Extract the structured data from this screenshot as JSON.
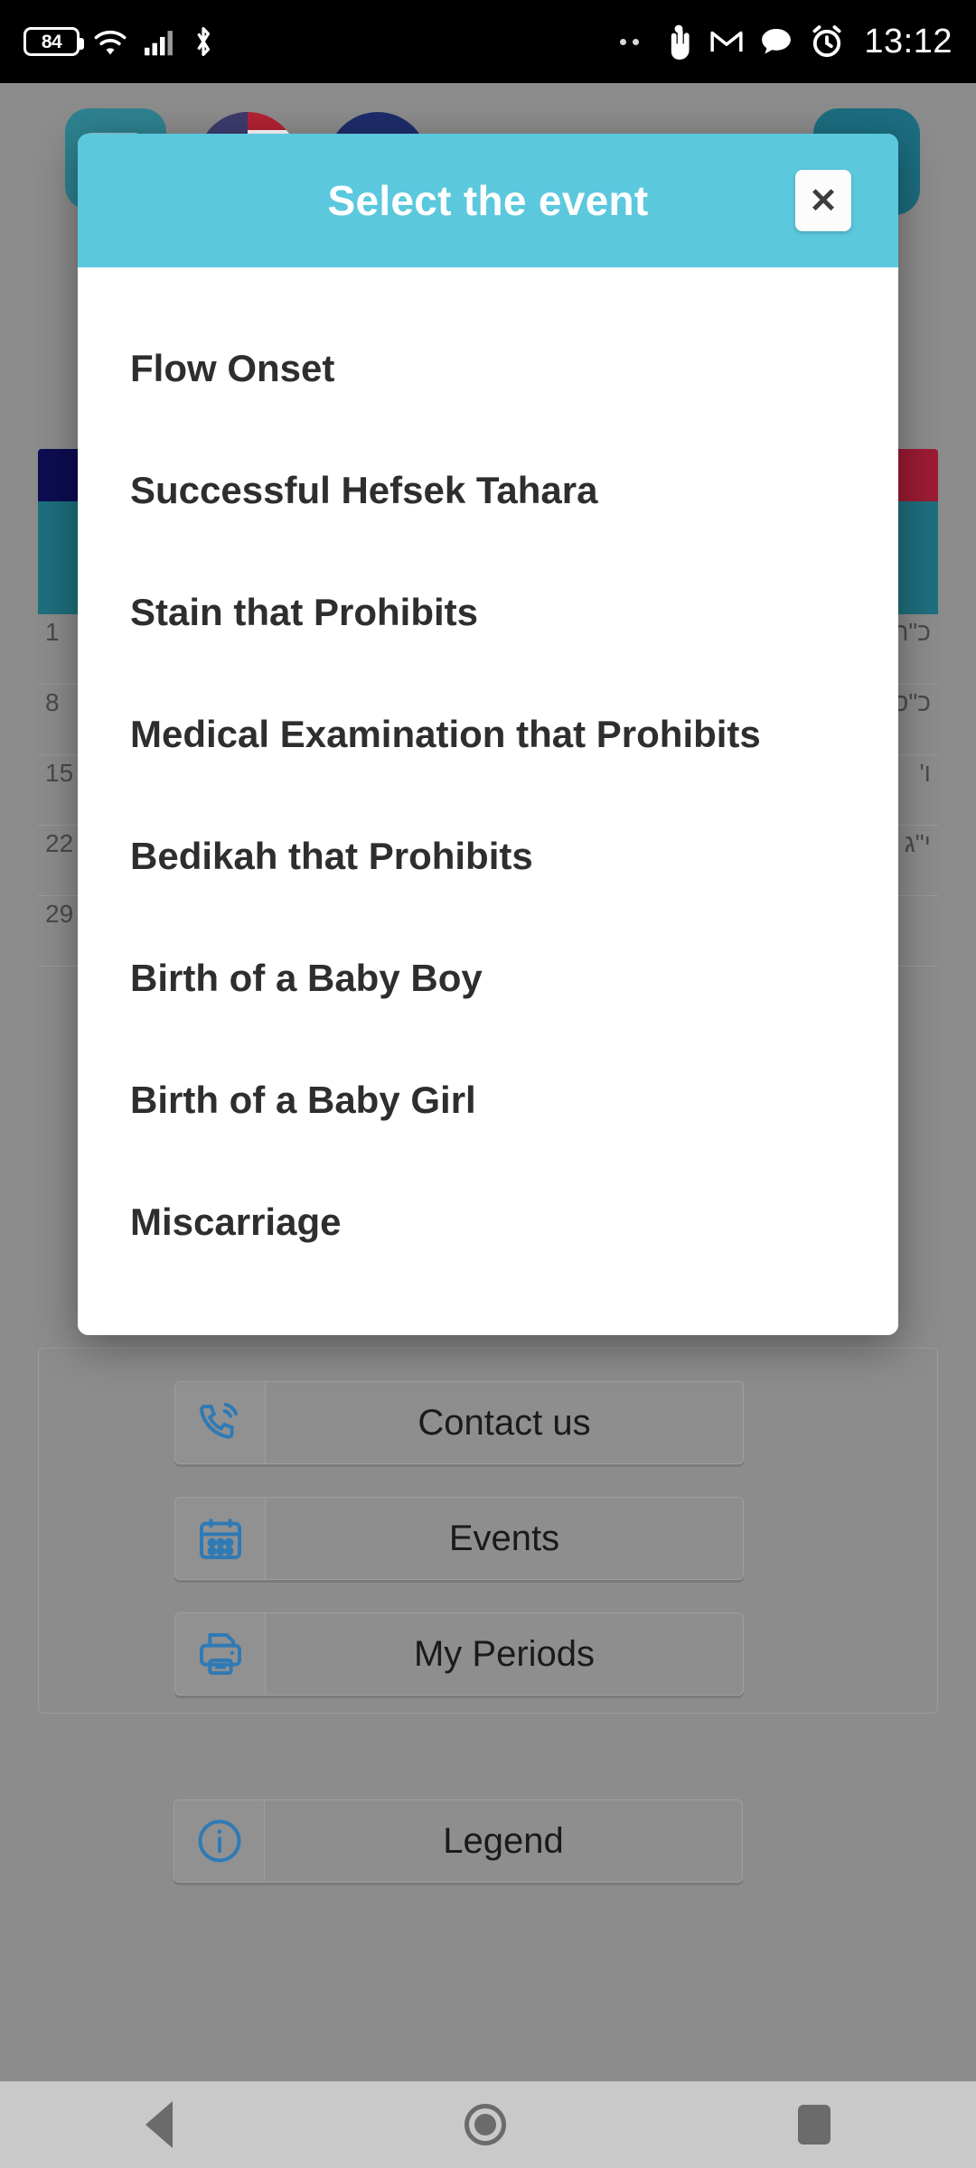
{
  "status_bar": {
    "battery_percent": "84",
    "icons_left": [
      "battery-icon",
      "wifi-icon",
      "signal-icon",
      "bluetooth-icon"
    ],
    "icons_right": [
      "two-dots-icon",
      "touch-hand-icon",
      "gmail-icon",
      "chat-bubble-icon",
      "alarm-clock-icon"
    ],
    "time": "13:12"
  },
  "dialog": {
    "title": "Select the event",
    "close_label": "✕",
    "header_color": "#5bc8dd",
    "items": [
      {
        "label": "Flow Onset"
      },
      {
        "label": "Successful Hefsek Tahara"
      },
      {
        "label": "Stain that Prohibits"
      },
      {
        "label": "Medical Examination that Prohibits"
      },
      {
        "label": "Bedikah that Prohibits"
      },
      {
        "label": "Birth of a Baby Boy"
      },
      {
        "label": "Birth of a Baby Girl"
      },
      {
        "label": "Miscarriage"
      }
    ]
  },
  "background": {
    "calendar": {
      "day_numbers": [
        "1",
        "8",
        "15",
        "22",
        "29"
      ],
      "hebrew_labels": [
        "כ\"ה",
        "כ\"ס",
        "ו'",
        "י\"ג",
        ""
      ]
    },
    "buttons": [
      {
        "label": "Contact us",
        "icon": "phone-ring-icon"
      },
      {
        "label": "Events",
        "icon": "calendar-icon"
      },
      {
        "label": "My Periods",
        "icon": "printer-icon"
      },
      {
        "label": "Legend",
        "icon": "info-icon"
      }
    ],
    "accent_blue": "#2f7ab5"
  },
  "nav_bar": {
    "back": "back-icon",
    "home": "home-icon",
    "recents": "recents-icon"
  }
}
